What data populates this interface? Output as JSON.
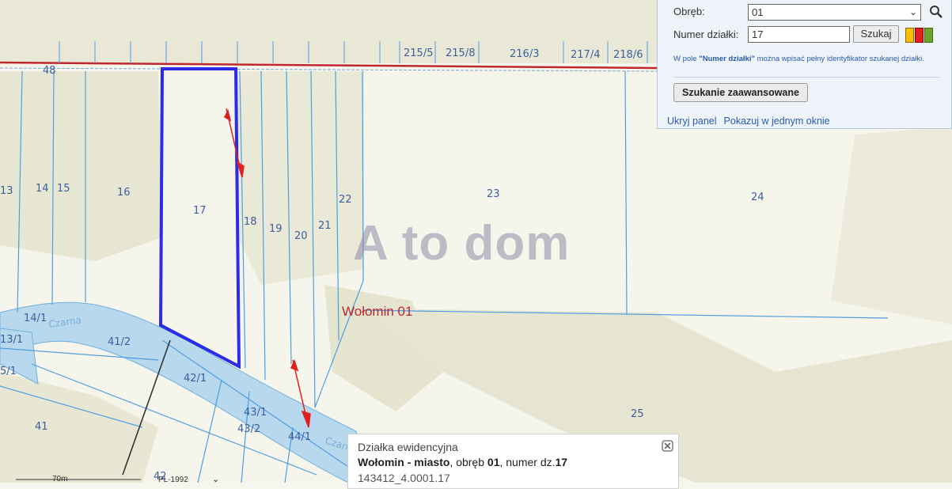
{
  "map": {
    "parcels": [
      "48",
      "215/5",
      "215/8",
      "216/3",
      "217/4",
      "218/6",
      "13",
      "14",
      "15",
      "16",
      "17",
      "18",
      "19",
      "20",
      "21",
      "22",
      "23",
      "24",
      "14/1",
      "13/1",
      "41/2",
      "5/1",
      "42/1",
      "43/1",
      "43/2",
      "44/1",
      "41",
      "25",
      "42"
    ],
    "watermark": "A to dom",
    "obreb_label": "Wołomin 01",
    "river_label_1": "Czarna",
    "river_label_2": "Czarna",
    "scale_text": "70m",
    "crs_text": "PL-1992",
    "colors": {
      "highlight": "#2b2be8",
      "road": "#c0272d",
      "parcel_line": "#4f9ee0",
      "river": "#b8d8ee"
    }
  },
  "panel": {
    "obreb_label": "Obręb:",
    "obreb_value": "01",
    "parcel_label": "Numer działki:",
    "parcel_value": "17",
    "search_button": "Szukaj",
    "hint_prefix": "W pole ",
    "hint_bold": "\"Numer działki\"",
    "hint_suffix": " można wpisać pełny identyfikator szukanej działki.",
    "advanced_button": "Szukanie zaawansowane",
    "link_hide": "Ukryj panel",
    "link_window": "Pokazuj w jednym oknie",
    "status_colors": [
      "#f5c000",
      "#e02020",
      "#6fa52a"
    ]
  },
  "popup": {
    "title": "Działka ewidencyjna",
    "place": "Wołomin - miasto",
    "mid1": ", obręb ",
    "obreb": "01",
    "mid2": ", numer dz.",
    "number": "17",
    "identifier": "143412_4.0001.17"
  }
}
